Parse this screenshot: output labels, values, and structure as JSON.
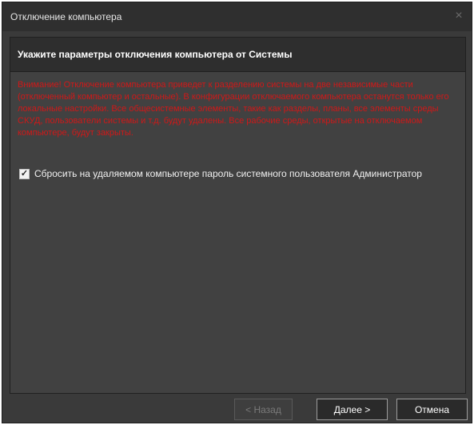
{
  "window": {
    "title": "Отключение компьютера",
    "close_icon": "×"
  },
  "panel": {
    "header": "Укажите параметры отключения компьютера от Системы",
    "warning": "Внимание! Отключение компьютера приведет к разделению системы на две независимые части (отключенный компьютер и остальные). В конфигурации отключаемого компьютера останутся только его локальные настройки. Все общесистемные элементы, такие как разделы, планы, все элементы среды СКУД, пользователи системы и т.д. будут удалены. Все рабочие среды, открытые на отключаемом компьютере, будут закрыты.",
    "option": {
      "label": "Сбросить на удаляемом компьютере пароль системного пользователя Администратор",
      "checked": true
    }
  },
  "buttons": {
    "back": "< Назад",
    "next": "Далее >",
    "cancel": "Отмена"
  },
  "colors": {
    "warning_text": "#d01818",
    "window_bg": "#3a3a3a"
  }
}
